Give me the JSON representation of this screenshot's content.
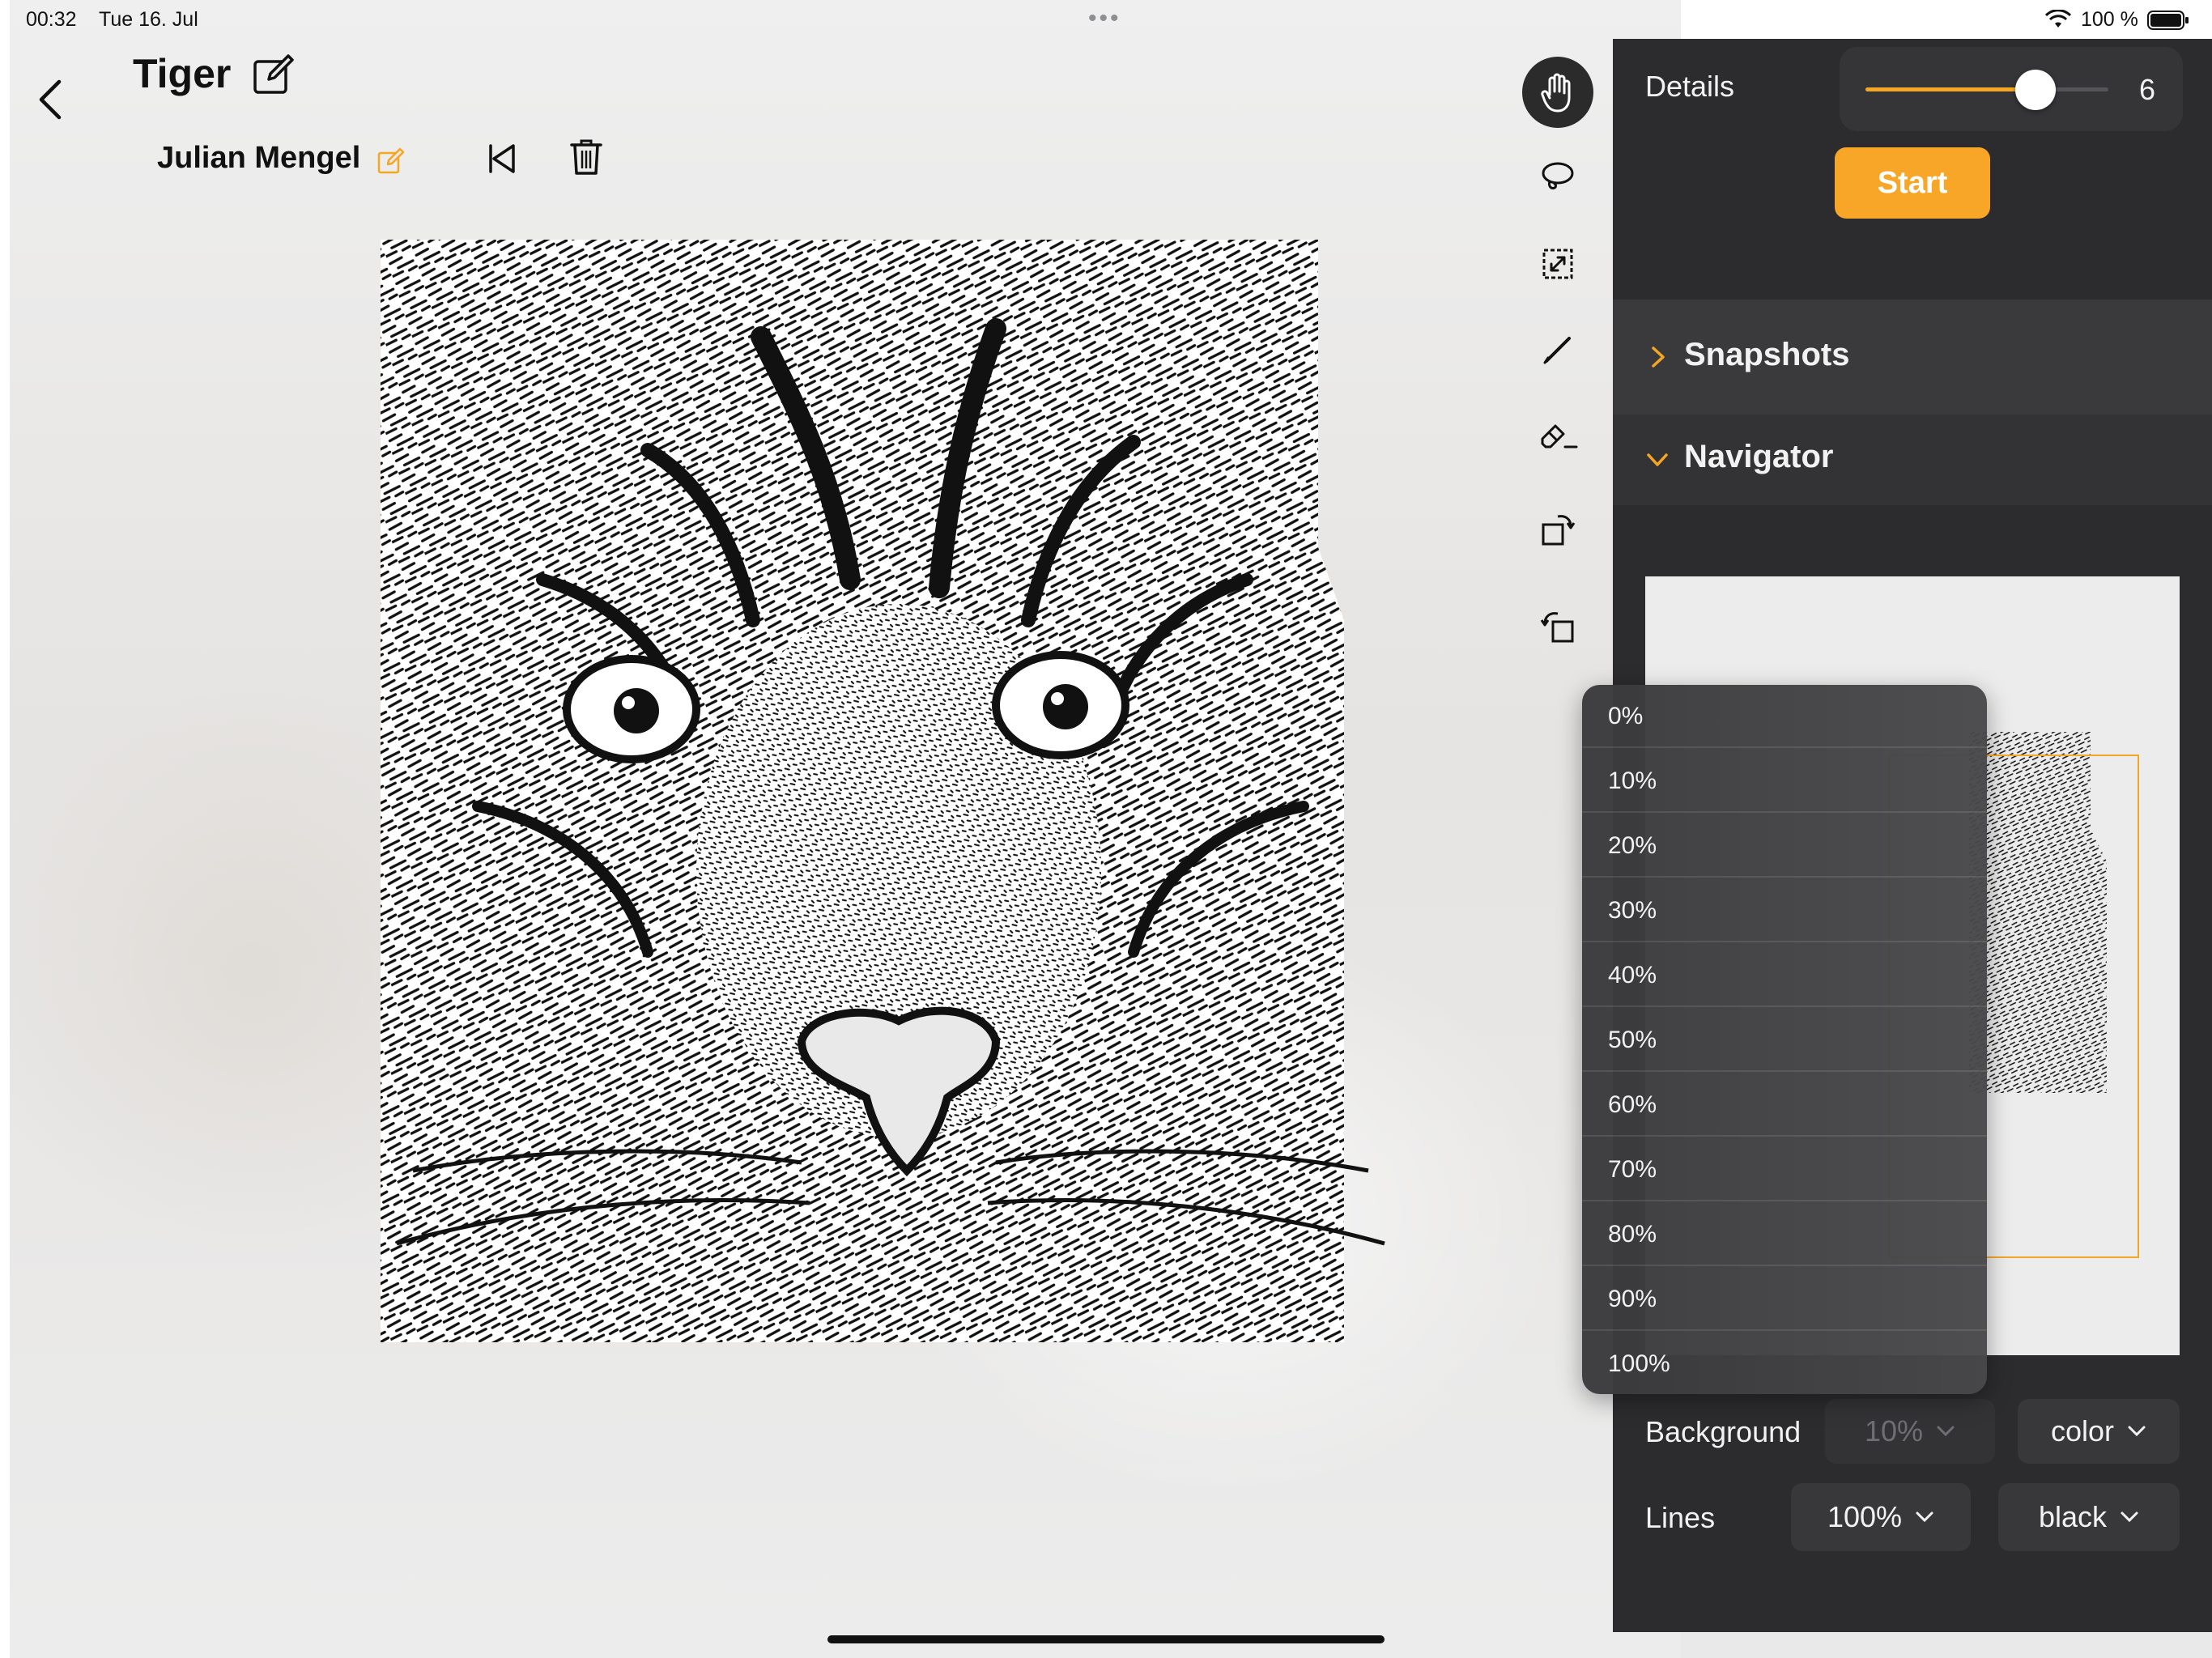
{
  "status_bar": {
    "time": "00:32",
    "date": "Tue 16. Jul",
    "battery_text": "100 %"
  },
  "document": {
    "title": "Tiger",
    "author": "Julian Mengel"
  },
  "panel": {
    "details_label": "Details",
    "details_value": "6",
    "details_fraction": 0.7,
    "start_label": "Start",
    "snapshots_label": "Snapshots",
    "navigator_label": "Navigator",
    "background_label": "Background",
    "background_opacity": "10%",
    "background_color": "color",
    "lines_label": "Lines",
    "lines_opacity": "100%",
    "lines_color": "black"
  },
  "dropdown": {
    "options": [
      "0%",
      "10%",
      "20%",
      "30%",
      "40%",
      "50%",
      "60%",
      "70%",
      "80%",
      "90%",
      "100%"
    ]
  },
  "colors": {
    "accent": "#f5a623",
    "panel_bg": "#2c2c2e"
  },
  "icons": {
    "toolbar": [
      "hand-icon",
      "lasso-icon",
      "resize-icon",
      "pen-icon",
      "eraser-icon",
      "rotate-right-icon",
      "rotate-left-icon"
    ]
  }
}
